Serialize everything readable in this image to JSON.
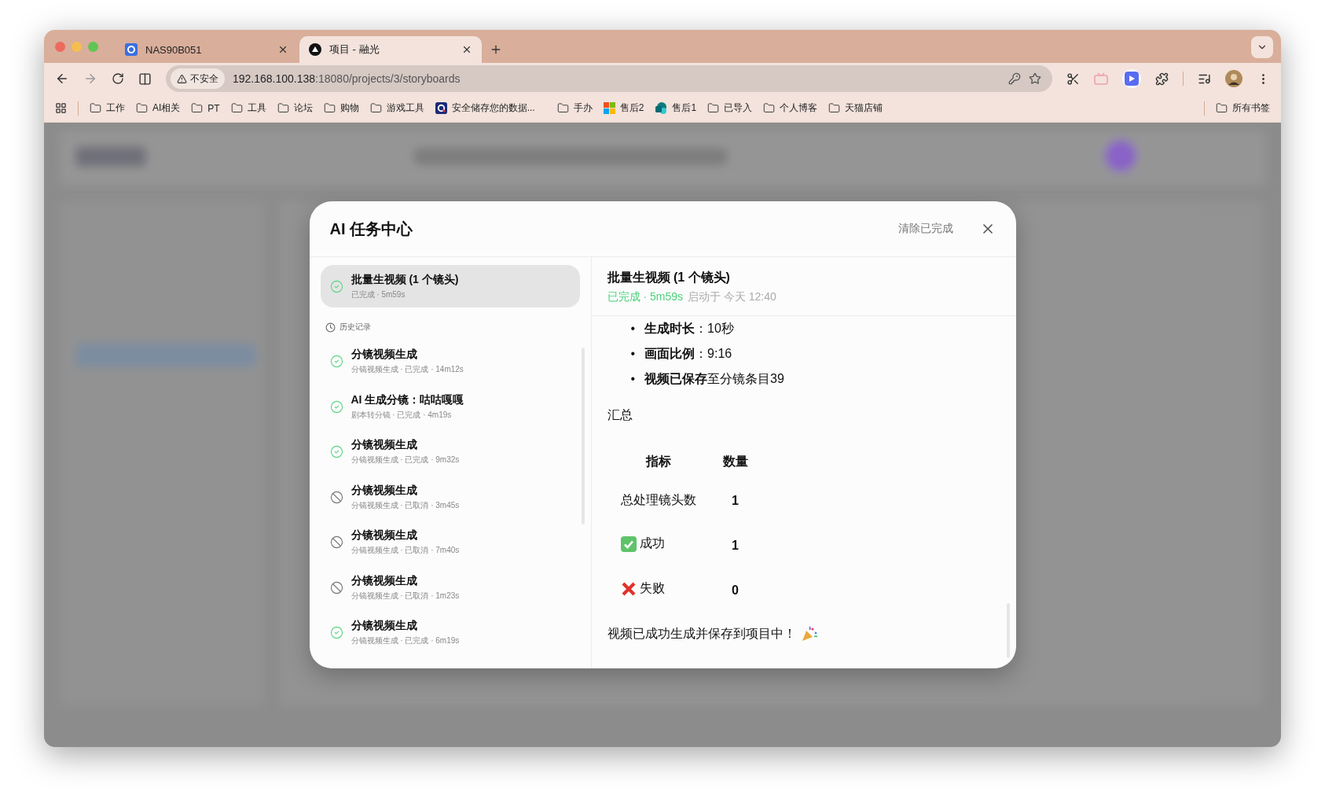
{
  "browser": {
    "tabs": [
      {
        "title": "NAS90B051",
        "kind": "nas",
        "selected": false
      },
      {
        "title": "项目 - 融光",
        "kind": "app",
        "selected": true
      }
    ],
    "address": {
      "security": "不安全",
      "host": "192.168.100.138",
      "rest": ":18080/projects/3/storyboards"
    },
    "bookmarks": [
      {
        "label": "工作",
        "kind": "folder"
      },
      {
        "label": "AI相关",
        "kind": "folder"
      },
      {
        "label": "PT",
        "kind": "folder"
      },
      {
        "label": "工具",
        "kind": "folder"
      },
      {
        "label": "论坛",
        "kind": "folder"
      },
      {
        "label": "购物",
        "kind": "folder"
      },
      {
        "label": "游戏工具",
        "kind": "folder"
      },
      {
        "label": "安全储存您的数据...",
        "kind": "site"
      },
      {
        "label": "手办",
        "kind": "folder"
      },
      {
        "label": "售后2",
        "kind": "tiles"
      },
      {
        "label": "售后1",
        "kind": "share"
      },
      {
        "label": "已导入",
        "kind": "folder"
      },
      {
        "label": "个人博客",
        "kind": "folder"
      },
      {
        "label": "天猫店铺",
        "kind": "folder"
      }
    ],
    "all_bookmarks": "所有书签"
  },
  "dialog": {
    "title": "AI 任务中心",
    "clear_button": "清除已完成",
    "current_task": {
      "title": "批量生视频 (1 个镜头)",
      "meta": "已完成 · 5m59s",
      "kind": "done",
      "selected": true
    },
    "history_label": "历史记录",
    "history": [
      {
        "title": "分镜视频生成",
        "meta": "分镜视频生成 · 已完成 · 14m12s",
        "kind": "done",
        "selected": false
      },
      {
        "title": "AI 生成分镜：咕咕嘎嘎",
        "meta": "剧本转分镜 · 已完成 · 4m19s",
        "kind": "done",
        "selected": false
      },
      {
        "title": "分镜视频生成",
        "meta": "分镜视频生成 · 已完成 · 9m32s",
        "kind": "done",
        "selected": false
      },
      {
        "title": "分镜视频生成",
        "meta": "分镜视频生成 · 已取消 · 3m45s",
        "kind": "cancelled",
        "selected": false
      },
      {
        "title": "分镜视频生成",
        "meta": "分镜视频生成 · 已取消 · 7m40s",
        "kind": "cancelled",
        "selected": false
      },
      {
        "title": "分镜视频生成",
        "meta": "分镜视频生成 · 已取消 · 1m23s",
        "kind": "cancelled",
        "selected": false
      },
      {
        "title": "分镜视频生成",
        "meta": "分镜视频生成 · 已完成 · 6m19s",
        "kind": "done",
        "selected": false
      }
    ],
    "detail": {
      "title": "批量生视频 (1 个镜头)",
      "kind": "done",
      "status_text": "已完成 · 5m59s",
      "started": "启动于 今天 12:40",
      "bullets": [
        {
          "marker": "•",
          "text": "**生成时长**：10秒"
        },
        {
          "marker": "•",
          "text": "**画面比例**：9:16"
        },
        {
          "marker": "•",
          "text": "**视频已保存**至分镜条目39"
        }
      ],
      "summary_heading": "汇总",
      "table": {
        "columns": [
          "指标",
          "数量"
        ],
        "rows": [
          {
            "metric": "总处理镜头数",
            "value": "1"
          },
          {
            "kind": "check",
            "metric": "成功",
            "value": "1"
          },
          {
            "kind": "cross",
            "metric": "失败",
            "value": "0"
          }
        ]
      },
      "closing": "视频已成功生成并保存到项目中！"
    }
  }
}
